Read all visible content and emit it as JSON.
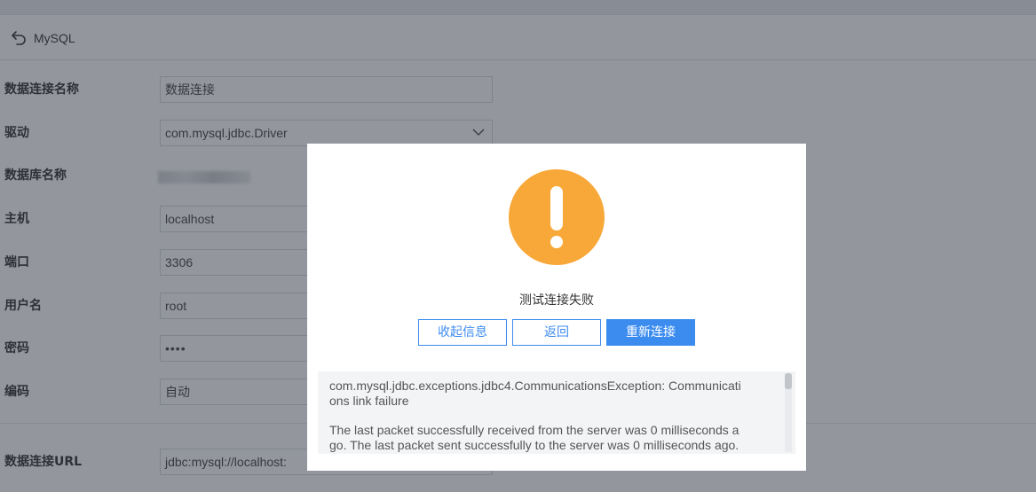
{
  "header": {
    "title": "MySQL"
  },
  "form": {
    "connection_name": {
      "label": "数据连接名称",
      "value": "数据连接"
    },
    "driver": {
      "label": "驱动",
      "value": "com.mysql.jdbc.Driver"
    },
    "database_name": {
      "label": "数据库名称"
    },
    "host": {
      "label": "主机",
      "value": "localhost"
    },
    "port": {
      "label": "端口",
      "value": "3306"
    },
    "username": {
      "label": "用户名",
      "value": "root"
    },
    "password": {
      "label": "密码",
      "value": "••••"
    },
    "encoding": {
      "label": "编码",
      "value": "自动"
    },
    "url": {
      "label": "数据连接URL",
      "value": "jdbc:mysql://localhost:"
    }
  },
  "dialog": {
    "icon": "warning-icon",
    "message": "测试连接失败",
    "buttons": {
      "collapse": "收起信息",
      "back": "返回",
      "reconnect": "重新连接"
    },
    "error_lines": [
      "com.mysql.jdbc.exceptions.jdbc4.CommunicationsException: Communicati",
      "ons link failure",
      "The last packet successfully received from the server was 0 milliseconds a",
      "go.  The last packet sent successfully to the server was 0 milliseconds ago."
    ]
  },
  "colors": {
    "accent": "#3c8cf0",
    "warning": "#f8a839",
    "overlay": "rgba(40,46,58,0.5)"
  }
}
